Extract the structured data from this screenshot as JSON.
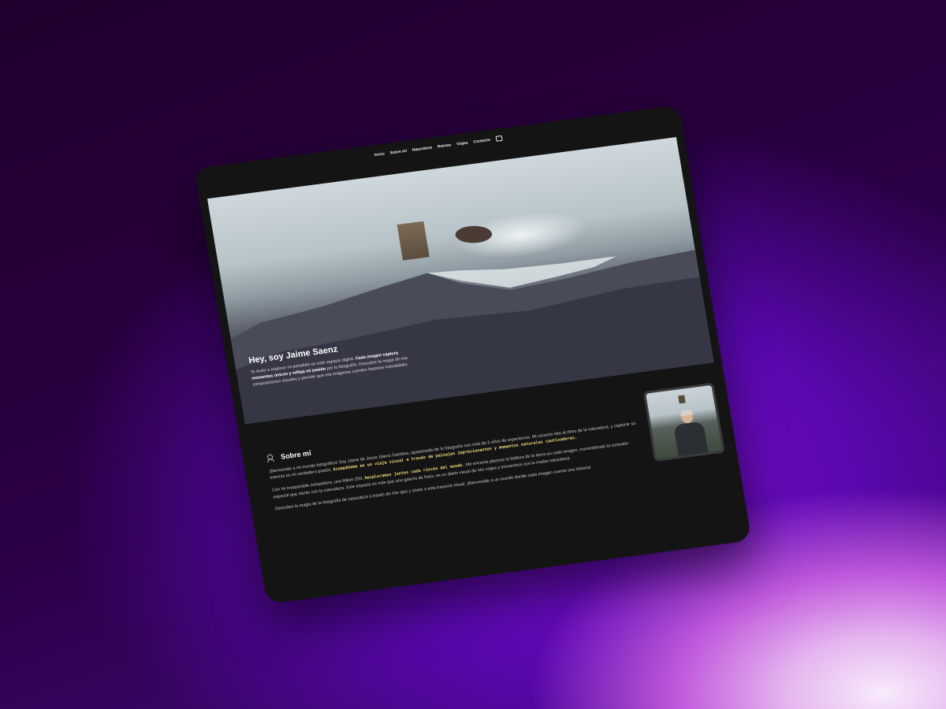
{
  "nav": {
    "items": [
      "Inicio",
      "Sobre mí",
      "Naturaleza",
      "Retrato",
      "Viajes",
      "Contacto"
    ],
    "icon": "monitor-icon"
  },
  "hero": {
    "title": "Hey, soy Jaime Saenz",
    "p1": "Te invito a explorar mi portafolio en este espacio digital. ",
    "p1_bold": "Cada imagen captura momentos únicos y refleja mi pasión",
    "p1_end": " por la fotografía. Descubre la magia de mis composiciones visuales y permite que mis imágenes cuenten historias inolvidables."
  },
  "about": {
    "icon": "user-icon",
    "title": "Sobre mí",
    "p1_a": "¡Bienvenido a mi mundo fotográfico! Soy Jaime de Jesús Sáenz Gamboa, apasionado de la fotografía con más de 6 años de experiencia. Mi corazón late al ritmo de la naturaleza, y capturar su esencia es mi verdadera pasión. ",
    "p1_hl": "Acompáñame en un viaje visual a través de paisajes impresionantes y momentos naturales cautivadores.",
    "p2_a": "Con mi inseparable compañera, una Nikon Z50, ",
    "p2_hl": "Aexploramos juntos cada rincón del mundo.",
    "p2_b": " Me encanta plasmar la belleza de la tierra en cada imagen, transmitiendo la conexión especial que siento con la naturaleza. Este espacio es más que una galería de fotos, es un diario visual de mis viajes y encuentros con la madre naturaleza.",
    "p3": "Descubre la magia de la fotografía de naturaleza a través de mis ojos y únete a esta travesía visual. ¡Bienvenido a un mundo donde cada imagen cuenta una historia!"
  }
}
